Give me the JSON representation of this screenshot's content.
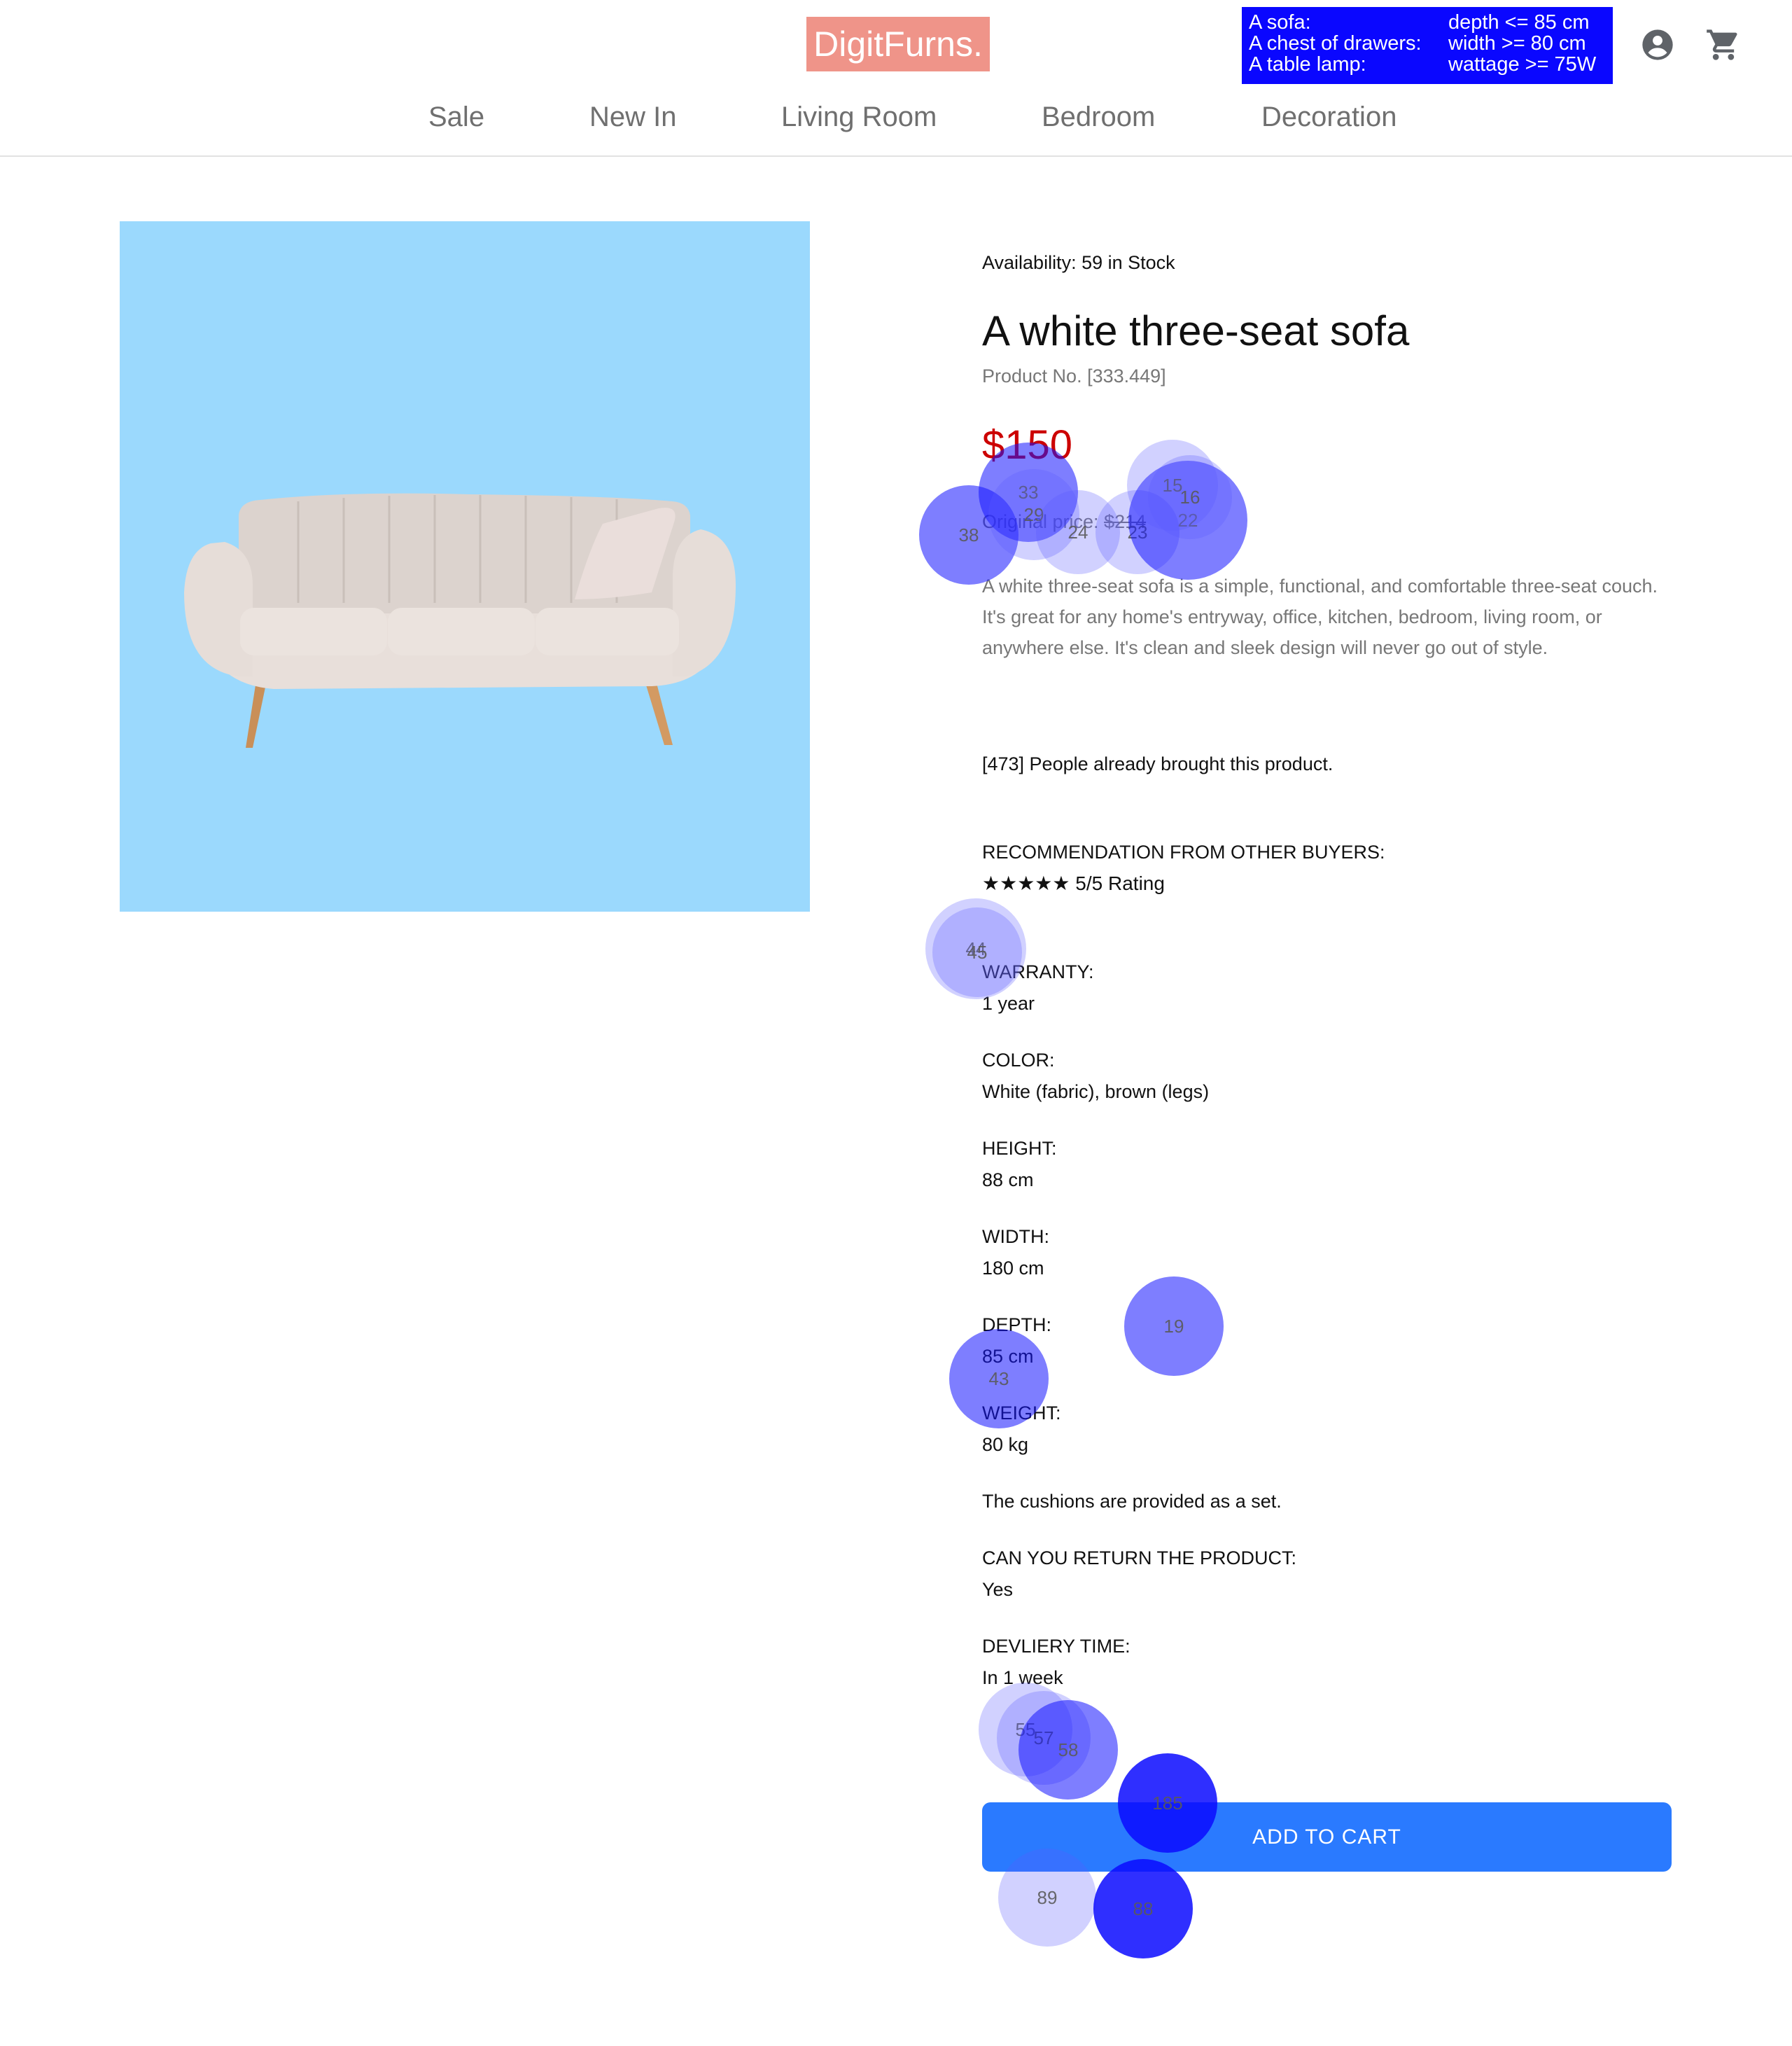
{
  "header": {
    "logo": "DigitFurns.",
    "criteria": [
      {
        "item": "A sofa:",
        "rule": "depth <= 85 cm"
      },
      {
        "item": "A chest of drawers:",
        "rule": "width >= 80 cm"
      },
      {
        "item": "A table lamp:",
        "rule": "wattage >= 75W"
      }
    ],
    "icons": [
      "account-icon",
      "cart-icon"
    ],
    "nav": [
      "Sale",
      "New In",
      "Living Room",
      "Bedroom",
      "Decoration"
    ]
  },
  "product": {
    "availability": "Availability: 59 in Stock",
    "title": "A white three-seat sofa",
    "product_no": "Product No. [333.449]",
    "price": "$150",
    "original_label": "Original price: ",
    "original_price": "$214",
    "description": "A white three-seat sofa is a simple, functional, and comfortable three-seat couch. It's great for any home's entryway, office, kitchen, bedroom, living room, or anywhere else. It's clean and sleek design will never go out of style.",
    "bought": "[473] People already brought this product.",
    "recommendation_label": "RECOMMENDATION FROM OTHER BUYERS:",
    "stars": "★★★★★",
    "rating": "5/5 Rating",
    "specs": [
      {
        "label": "WARRANTY:",
        "value": "1 year"
      },
      {
        "label": "COLOR:",
        "value": "White (fabric), brown (legs)"
      },
      {
        "label": "HEIGHT:",
        "value": "88 cm"
      },
      {
        "label": "WIDTH:",
        "value": "180 cm"
      },
      {
        "label": "DEPTH:",
        "value": "85 cm"
      },
      {
        "label": "WEIGHT:",
        "value": "80 kg"
      }
    ],
    "cushions": "The cushions are provided as a set.",
    "return_label": "CAN YOU RETURN THE PRODUCT:",
    "return_value": "Yes",
    "delivery_label": "DEVLIERY TIME:",
    "delivery_value": "In 1 week",
    "add_to_cart": "ADD TO CART"
  },
  "colors": {
    "logo_bg": "#ef9489",
    "criteria_bg": "#0a07ff",
    "price": "#cc0000",
    "image_bg": "#9bd9fd",
    "button": "#2a7aff"
  },
  "gaze_labels": [
    "38",
    "33",
    "29",
    "24",
    "23",
    "22",
    "15",
    "16",
    "44",
    "45",
    "19",
    "43",
    "55",
    "57",
    "58",
    "185",
    "89",
    "88"
  ]
}
